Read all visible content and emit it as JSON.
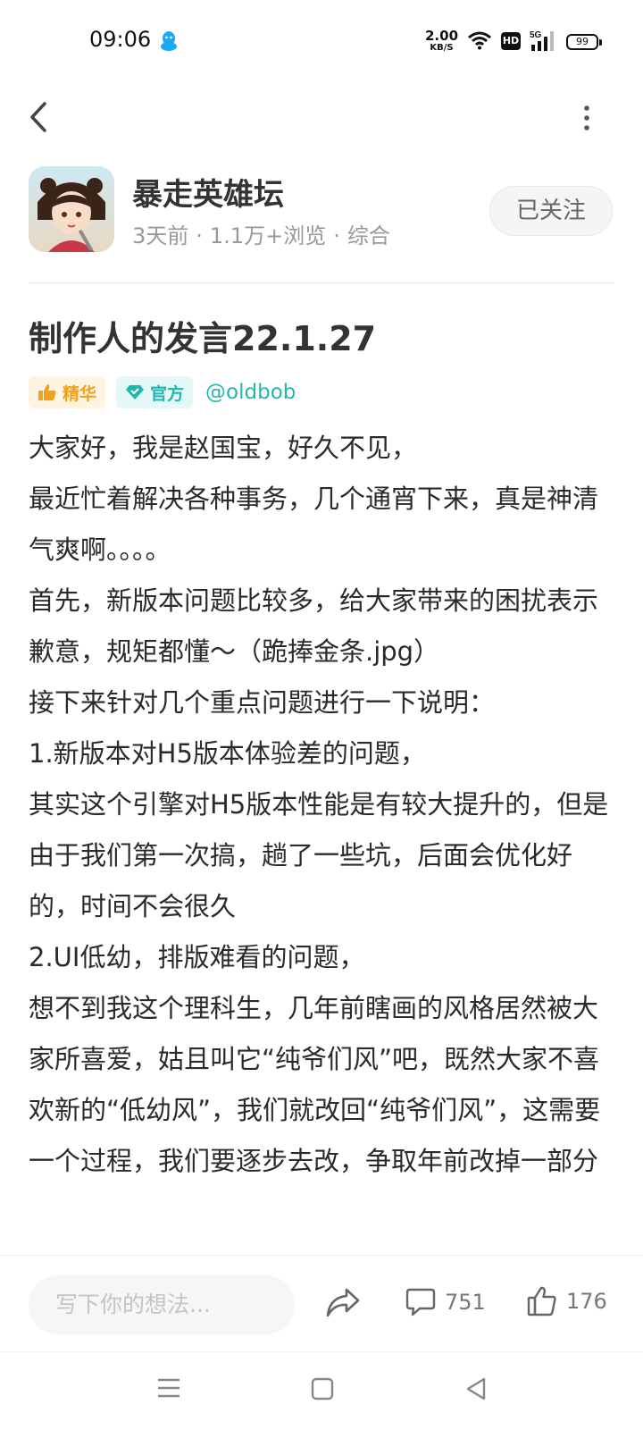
{
  "status_bar": {
    "time": "09:06",
    "net_speed": "2.00",
    "net_unit": "KB/S",
    "hd_label": "HD",
    "signal_label": "5G",
    "battery": "99"
  },
  "author": {
    "name": "暴走英雄坛",
    "time_ago": "3天前",
    "views": "1.1万+浏览",
    "category": "综合",
    "separator": "·",
    "follow_label": "已关注"
  },
  "post": {
    "title": "制作人的发言22.1.27",
    "tags": [
      "精华",
      "官方"
    ],
    "handle": "@oldbob",
    "paragraphs": [
      "大家好，我是赵国宝，好久不见，",
      "最近忙着解决各种事务，几个通宵下来，真是神清气爽啊。。。。",
      "首先，新版本问题比较多，给大家带来的困扰表示歉意，规矩都懂～（跪捧金条.jpg）",
      "接下来针对几个重点问题进行一下说明：",
      "1.新版本对H5版本体验差的问题，",
      "其实这个引擎对H5版本性能是有较大提升的，但是由于我们第一次搞，趟了一些坑，后面会优化好的，时间不会很久",
      "2.UI低幼，排版难看的问题，",
      "想不到我这个理科生，几年前瞎画的风格居然被大家所喜爱，姑且叫它“纯爷们风”吧，既然大家不喜欢新的“低幼风”，我们就改回“纯爷们风”，这需要一个过程，我们要逐步去改，争取年前改掉一部分"
    ]
  },
  "bottom_bar": {
    "input_placeholder": "写下你的想法...",
    "comment_count": "751",
    "like_count": "176"
  },
  "colors": {
    "accent_teal": "#27b4b0",
    "essence_orange": "#f2a11c"
  }
}
